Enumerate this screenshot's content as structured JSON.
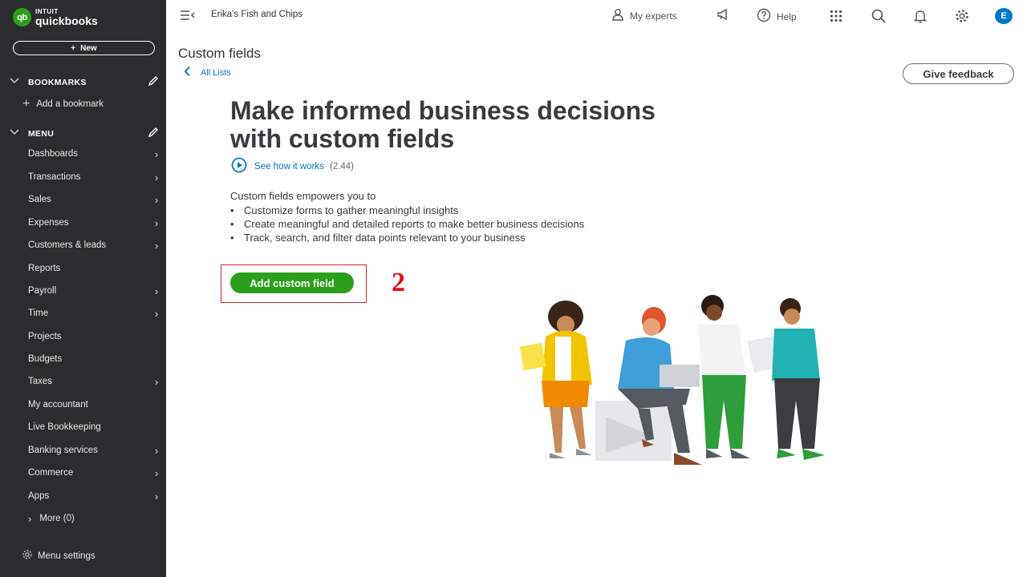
{
  "sidebar": {
    "logo": {
      "mark": "qb",
      "brand_top": "INTUIT",
      "brand_bottom": "quickbooks"
    },
    "new_button": {
      "icon": "+",
      "label": "New"
    },
    "bookmarks": {
      "title": "BOOKMARKS",
      "add_label": "Add a bookmark"
    },
    "menu": {
      "title": "MENU",
      "items": [
        {
          "label": "Dashboards",
          "arrow": "›"
        },
        {
          "label": "Transactions",
          "arrow": "›"
        },
        {
          "label": "Sales",
          "arrow": "›"
        },
        {
          "label": "Expenses",
          "arrow": "›"
        },
        {
          "label": "Customers & leads",
          "arrow": "›"
        },
        {
          "label": "Reports",
          "arrow": ""
        },
        {
          "label": "Payroll",
          "arrow": "›"
        },
        {
          "label": "Time",
          "arrow": "›"
        },
        {
          "label": "Projects",
          "arrow": ""
        },
        {
          "label": "Budgets",
          "arrow": ""
        },
        {
          "label": "Taxes",
          "arrow": "›"
        },
        {
          "label": "My accountant",
          "arrow": ""
        },
        {
          "label": "Live Bookkeeping",
          "arrow": ""
        },
        {
          "label": "Banking services",
          "arrow": "›"
        },
        {
          "label": "Commerce",
          "arrow": "›"
        },
        {
          "label": "Apps",
          "arrow": "›"
        }
      ],
      "more_label": "More (0)"
    },
    "menu_settings_label": "Menu settings"
  },
  "topbar": {
    "company_name": "Erika's Fish and Chips",
    "experts_label": "My experts",
    "help_label": "Help",
    "avatar_initial": "E"
  },
  "page": {
    "title": "Custom fields",
    "back_link": "All Lists",
    "feedback_button": "Give feedback",
    "headline_line1": "Make informed business decisions",
    "headline_line2": "with custom fields",
    "video_link": "See how it works",
    "video_duration": "(2.44)",
    "intro": "Custom fields empowers you to",
    "bullets": [
      "Customize forms to gather meaningful insights",
      "Create meaningful and detailed reports to make better business decisions",
      "Track, search, and filter data points relevant to your business"
    ],
    "add_button": "Add custom field",
    "step_number": "2"
  },
  "colors": {
    "sidebar_bg": "#2b2c2d",
    "brand_green": "#2ca01c",
    "link_blue": "#0077c5",
    "annotation_red": "#e01010"
  }
}
